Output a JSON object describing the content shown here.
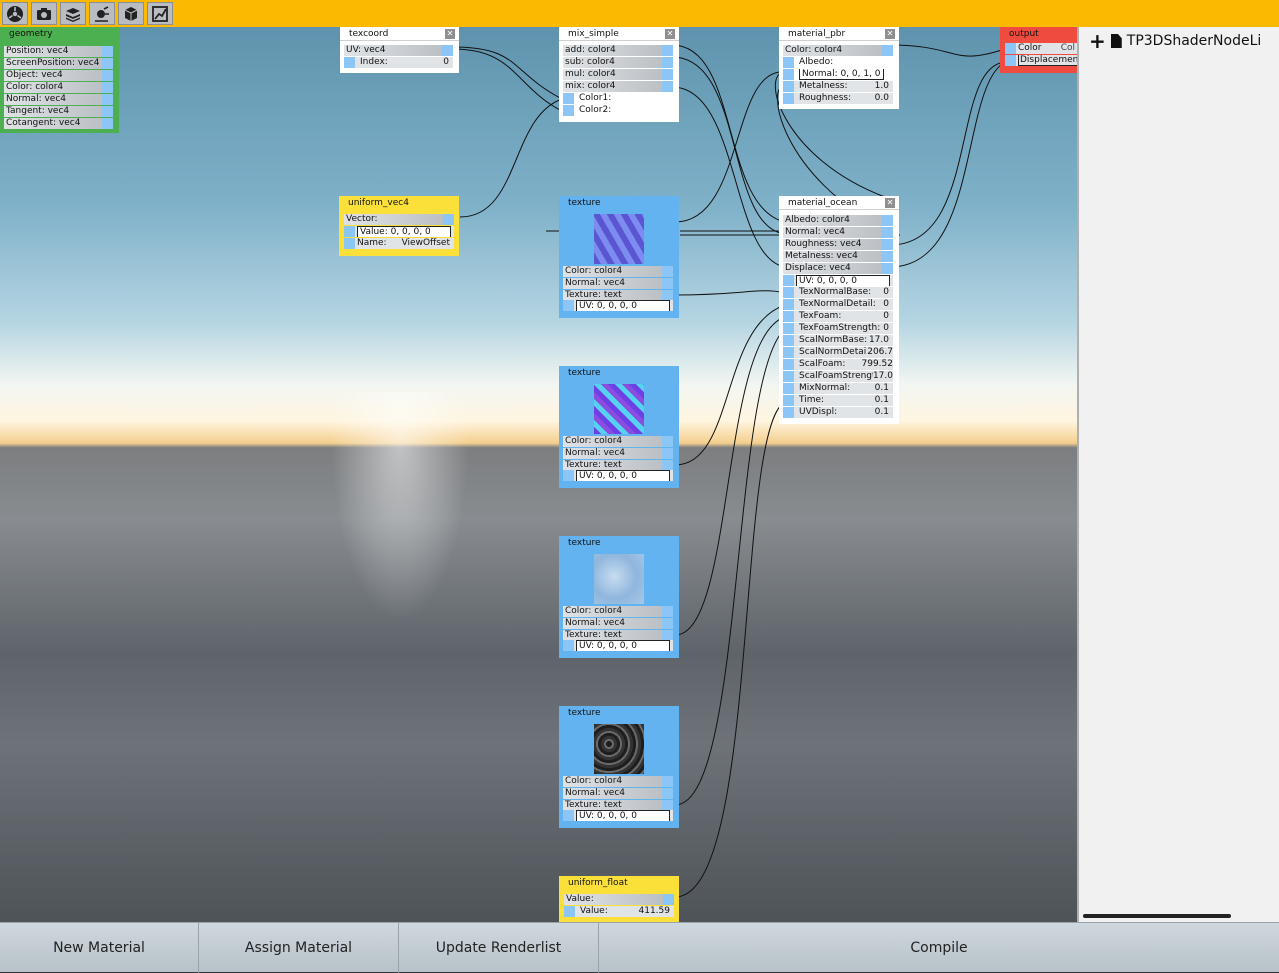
{
  "toolbar": {
    "icons": [
      "scene-tree-icon",
      "camera-icon",
      "layers-icon",
      "light-icon",
      "cube-icon",
      "graph-editor-icon"
    ]
  },
  "nodes": {
    "geometry": {
      "title": "geometry",
      "outputs": [
        "Position: vec4",
        "ScreenPosition: vec4",
        "Object: vec4",
        "Color: color4",
        "Normal: vec4",
        "Tangent: vec4",
        "Cotangent: vec4"
      ]
    },
    "texcoord": {
      "title": "texcoord",
      "output": "UV: vec4",
      "input_label": "Index:",
      "input_value": "0"
    },
    "mix_simple": {
      "title": "mix_simple",
      "outputs": [
        "add: color4",
        "sub: color4",
        "mul: color4",
        "mix: color4"
      ],
      "inputs": [
        "Color1:",
        "Color2:"
      ]
    },
    "material_pbr": {
      "title": "material_pbr",
      "output": "Color: color4",
      "albedo": "Albedo:",
      "normal": "Normal: 0, 0, 1, 0",
      "metalness_label": "Metalness:",
      "metalness_value": "1.0",
      "roughness_label": "Roughness:",
      "roughness_value": "0.0"
    },
    "output": {
      "title": "output",
      "color_label": "Color",
      "color_value": "Col",
      "displacement_label": "Displacement"
    },
    "uniform_vec4": {
      "title": "uniform_vec4",
      "output": "Vector:",
      "value": "Value: 0, 0, 0, 0",
      "name_label": "Name:",
      "name_value": "ViewOffset"
    },
    "material_ocean": {
      "title": "material_ocean",
      "outputs": [
        "Albedo: color4",
        "Normal: vec4",
        "Roughness: vec4",
        "Metalness: vec4",
        "Displace: vec4"
      ],
      "uv": "UV: 0, 0, 0, 0",
      "params": [
        {
          "label": "TexNormalBase:",
          "value": "0"
        },
        {
          "label": "TexNormalDetail:",
          "value": "0"
        },
        {
          "label": "TexFoam:",
          "value": "0"
        },
        {
          "label": "TexFoamStrength:",
          "value": "0"
        },
        {
          "label": "ScalNormBase:",
          "value": "17.0"
        },
        {
          "label": "ScalNormDetail:",
          "value": "206.7"
        },
        {
          "label": "ScalFoam:",
          "value": "799.52"
        },
        {
          "label": "ScalFoamStrength:",
          "value": "17.0"
        },
        {
          "label": "MixNormal:",
          "value": "0.1"
        },
        {
          "label": "Time:",
          "value": "0.1"
        },
        {
          "label": "UVDispl:",
          "value": "0.1"
        }
      ]
    },
    "textures": [
      {
        "title": "texture",
        "outputs": [
          "Color: color4",
          "Normal: vec4",
          "Texture: text"
        ],
        "uv": "UV: 0, 0, 0, 0",
        "swatch": [
          "#5a55d0",
          "#7d8cf0"
        ]
      },
      {
        "title": "texture",
        "outputs": [
          "Color: color4",
          "Normal: vec4",
          "Texture: text"
        ],
        "uv": "UV: 0, 0, 0, 0",
        "swatch": [
          "#6d3fe6",
          "#55d2f0"
        ]
      },
      {
        "title": "texture",
        "outputs": [
          "Color: color4",
          "Normal: vec4",
          "Texture: text"
        ],
        "uv": "UV: 0, 0, 0, 0",
        "swatch": [
          "#8fb6dd",
          "#c7dcf0"
        ]
      },
      {
        "title": "texture",
        "outputs": [
          "Color: color4",
          "Normal: vec4",
          "Texture: text"
        ],
        "uv": "UV: 0, 0, 0, 0",
        "swatch": [
          "#1e1e1e",
          "#6a6a6a"
        ]
      }
    ],
    "uniform_float": {
      "title": "uniform_float",
      "output": "Value:",
      "value_label": "Value:",
      "value": "411.59"
    }
  },
  "sidebar": {
    "item_label": "TP3DShaderNodeLi"
  },
  "bottom": {
    "new_material": "New Material",
    "assign_material": "Assign Material",
    "update_renderlist": "Update Renderlist",
    "compile": "Compile"
  },
  "colors": {
    "topbar": "#fbba00",
    "node_geometry": "#4caf50",
    "node_uniform": "#fbe039",
    "node_texture": "#63b3f1",
    "node_output": "#ef4b3e",
    "pin": "#8cc6f6"
  }
}
